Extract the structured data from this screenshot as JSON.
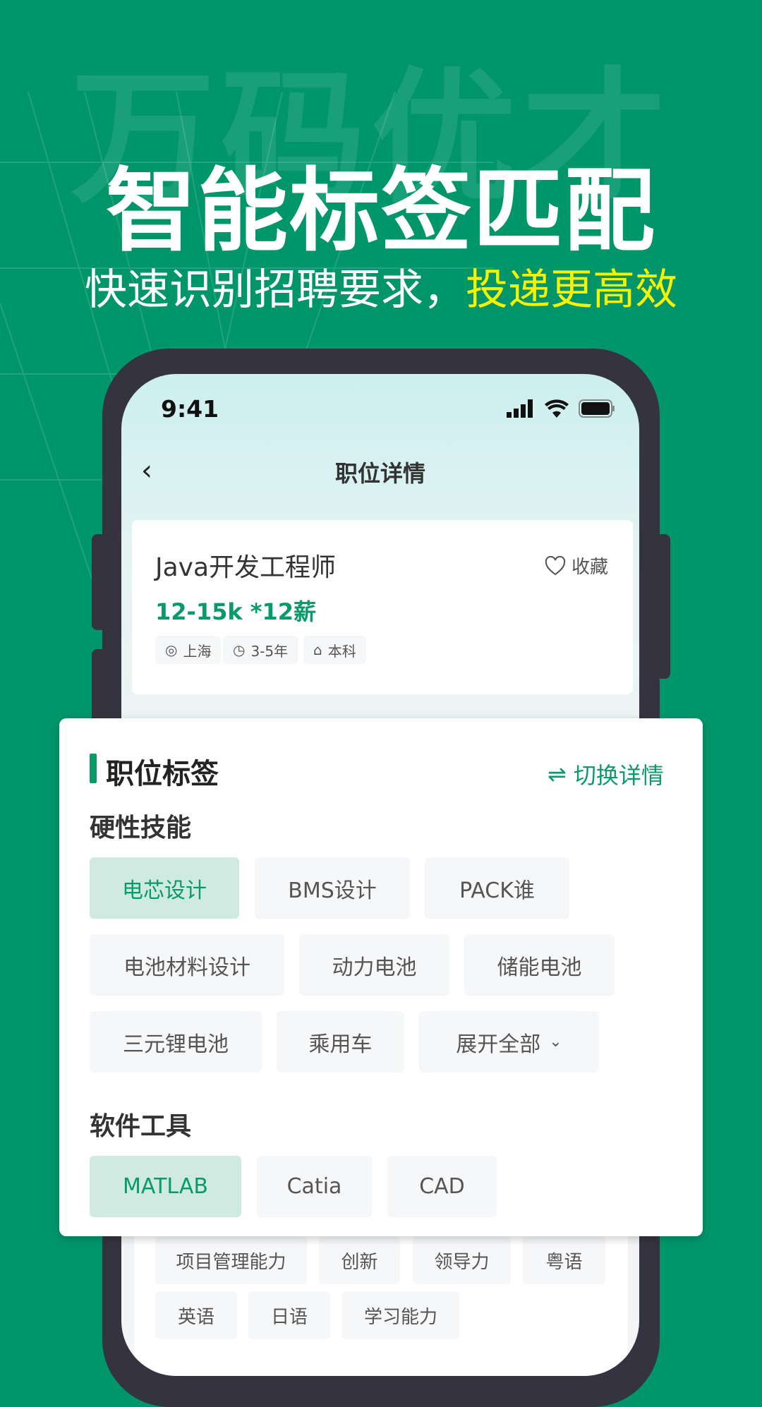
{
  "banner": {
    "watermark": "万码优才",
    "title": "智能标签匹配",
    "subtitle_main": "快速识别招聘要求，",
    "subtitle_highlight": "投递更高效",
    "highlight_color": "#f6f200",
    "bg_color": "#01966a"
  },
  "status_bar": {
    "time": "9:41",
    "icons": [
      "signal-icon",
      "wifi-icon",
      "battery-icon"
    ]
  },
  "nav": {
    "title": "职位详情",
    "back_icon": "chevron-left-icon"
  },
  "job": {
    "title": "Java开发工程师",
    "collect_label": "收藏",
    "salary": "12-15k *12薪",
    "meta": [
      {
        "icon": "location-icon",
        "label": "上海"
      },
      {
        "icon": "clock-icon",
        "label": "3-5年"
      },
      {
        "icon": "graduation-cap-icon",
        "label": "本科"
      }
    ]
  },
  "tags_panel": {
    "title": "职位标签",
    "switch_label": "切换详情",
    "hard_skills": {
      "label": "硬性技能",
      "tags": [
        "电芯设计",
        "BMS设计",
        "PACK谁",
        "电池材料设计",
        "动力电池",
        "储能电池",
        "三元锂电池",
        "乘用车"
      ],
      "active": "电芯设计",
      "expand_label": "展开全部"
    },
    "software": {
      "label": "软件工具",
      "tags": [
        "MATLAB",
        "Catia",
        "CAD"
      ],
      "active": "MATLAB"
    }
  },
  "background_tags": [
    "项目管理能力",
    "创新",
    "领导力",
    "粤语",
    "英语",
    "日语",
    "学习能力"
  ],
  "accent_color": "#0a9a6a"
}
